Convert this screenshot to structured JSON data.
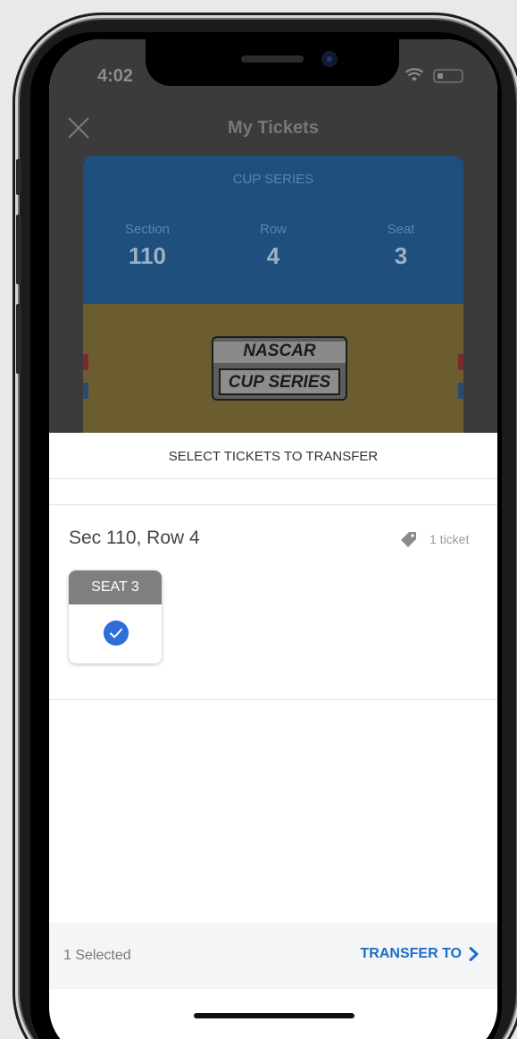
{
  "status_bar": {
    "time": "4:02"
  },
  "nav": {
    "title": "My Tickets"
  },
  "ticket": {
    "series": "CUP SERIES",
    "section_label": "Section",
    "section_value": "110",
    "row_label": "Row",
    "row_value": "4",
    "seat_label": "Seat",
    "seat_value": "3",
    "logo_line1": "NASCAR",
    "logo_line2": "CUP SERIES"
  },
  "sheet": {
    "title": "SELECT TICKETS TO TRANSFER",
    "group_label": "Sec 110, Row 4",
    "ticket_count": "1 ticket",
    "seats": [
      {
        "label": "SEAT 3",
        "selected": true
      }
    ]
  },
  "footer": {
    "selected_text": "1 Selected",
    "transfer_label": "TRANSFER TO"
  },
  "colors": {
    "accent": "#1e6cc7",
    "check": "#2d6ed8",
    "ticket_blue": "#1f4f7d"
  }
}
